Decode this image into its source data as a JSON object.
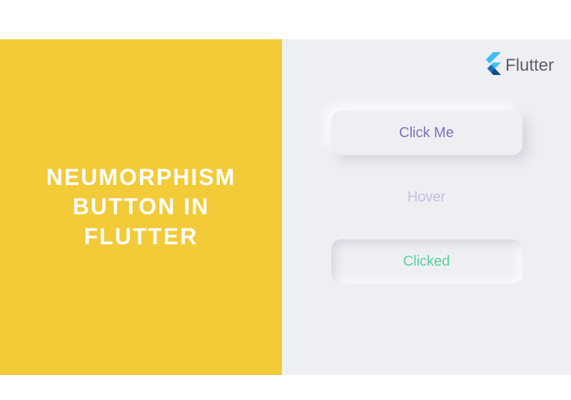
{
  "left": {
    "title_line1": "NEUMORPHISM",
    "title_line2": "BUTTON IN FLUTTER"
  },
  "logo": {
    "text": "Flutter"
  },
  "buttons": {
    "click_me": "Click Me",
    "hover": "Hover",
    "clicked": "Clicked"
  },
  "colors": {
    "yellow": "#f3ca37",
    "bg": "#eeeff3",
    "purple_text": "#7b6fb8",
    "hover_text": "#c3bde0",
    "clicked_text": "#5ad19a"
  }
}
